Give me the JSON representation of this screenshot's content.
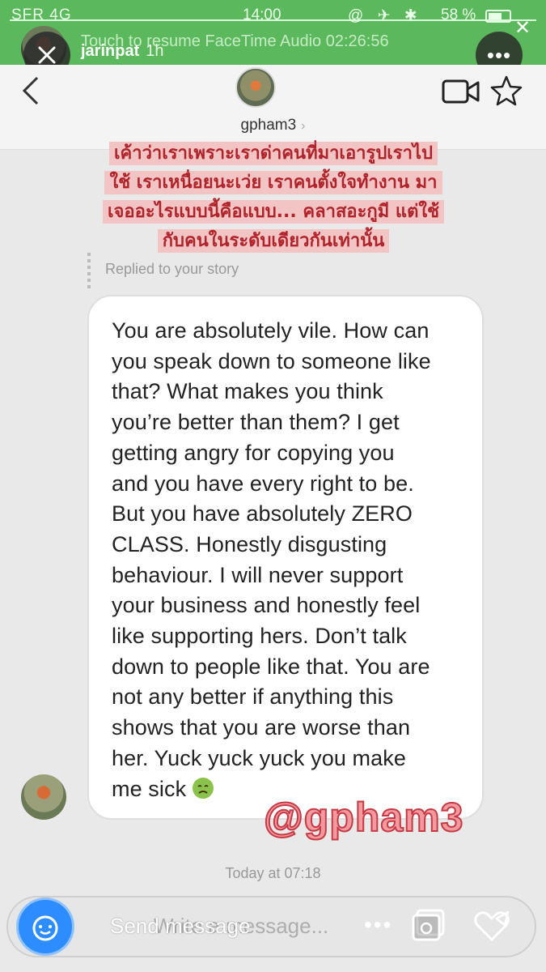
{
  "status_bar": {
    "carrier": "SFR 4G",
    "time": "14:00",
    "battery": "58 %",
    "facetime_banner": "Touch to resume FaceTime Audio 02:26:56"
  },
  "story": {
    "username": "jarinpat",
    "age": "1h"
  },
  "thread": {
    "username": "gpham3"
  },
  "caption": {
    "lines": [
      "เค้าว่าเราเพราะเราด่าคนที่มาเอารูปเราไป",
      "ใช้ เราเหนื่อยนะเว่ย เราคนตั้งใจทำงาน มา",
      "เจออะไรแบบนี้คือแบบ... คลาสอะกูมี แต่ใช้",
      "กับคนในระดับเดียวกันเท่านั้น"
    ]
  },
  "message": {
    "replied_label": "Replied to your story",
    "lines": [
      "You are absolutely vile. How can",
      "you speak down to someone like",
      "that? What makes you think",
      "you’re better than them? I get",
      "getting angry for copying you",
      "and you have every right to be.",
      "But you have absolutely ZERO",
      "CLASS. Honestly disgusting",
      "behaviour. I will never support",
      "your business and honestly feel",
      "like supporting hers. Don’t talk",
      "down to people like that. You are",
      "not any better if anything this",
      "shows that you are worse than",
      "her. Yuck yuck yuck you make",
      "me sick"
    ],
    "emoji": "nauseated-face"
  },
  "watermark": "@gpham3",
  "timestamp": "Today at 07:18",
  "composer": {
    "overlay_text": "Send message",
    "placeholder": "Write a message..."
  },
  "colors": {
    "status_green": "#5cb85c",
    "caption_text": "#b0232b",
    "caption_bg": "#f2c4c4",
    "camera_blue": "#2d8cff"
  }
}
